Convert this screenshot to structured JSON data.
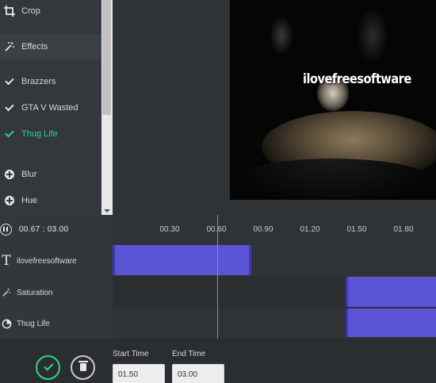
{
  "sidebar": {
    "items": [
      {
        "label": "Crop",
        "icon": "crop-icon"
      },
      {
        "label": "Effects",
        "icon": "magic-wand-icon"
      },
      {
        "label": "Brazzers",
        "icon": "check-icon"
      },
      {
        "label": "GTA V Wasted",
        "icon": "check-icon"
      },
      {
        "label": "Thug Life",
        "icon": "check-icon",
        "active": true
      },
      {
        "label": "Blur",
        "icon": "plus-circle-icon"
      },
      {
        "label": "Hue",
        "icon": "plus-circle-icon"
      }
    ]
  },
  "preview": {
    "watermark_text": "ilovefreesoftware"
  },
  "timeline": {
    "current_time": "00.67",
    "separator": ":",
    "total_time": "03.00",
    "ticks": [
      "00.30",
      "00.60",
      "00.90",
      "01.20",
      "01.50",
      "01.80"
    ],
    "tracks": [
      {
        "label": "ilovefreesoftware",
        "icon": "text-icon"
      },
      {
        "label": "Saturation",
        "icon": "magic-wand-icon"
      },
      {
        "label": "Thug Life",
        "icon": "effect-icon"
      }
    ]
  },
  "editor": {
    "start_label": "Start Time",
    "end_label": "End Time",
    "start_value": "01.50",
    "end_value": "03.00"
  },
  "colors": {
    "accent_green": "#2ed58c",
    "segment_blue": "#5b55d6"
  }
}
